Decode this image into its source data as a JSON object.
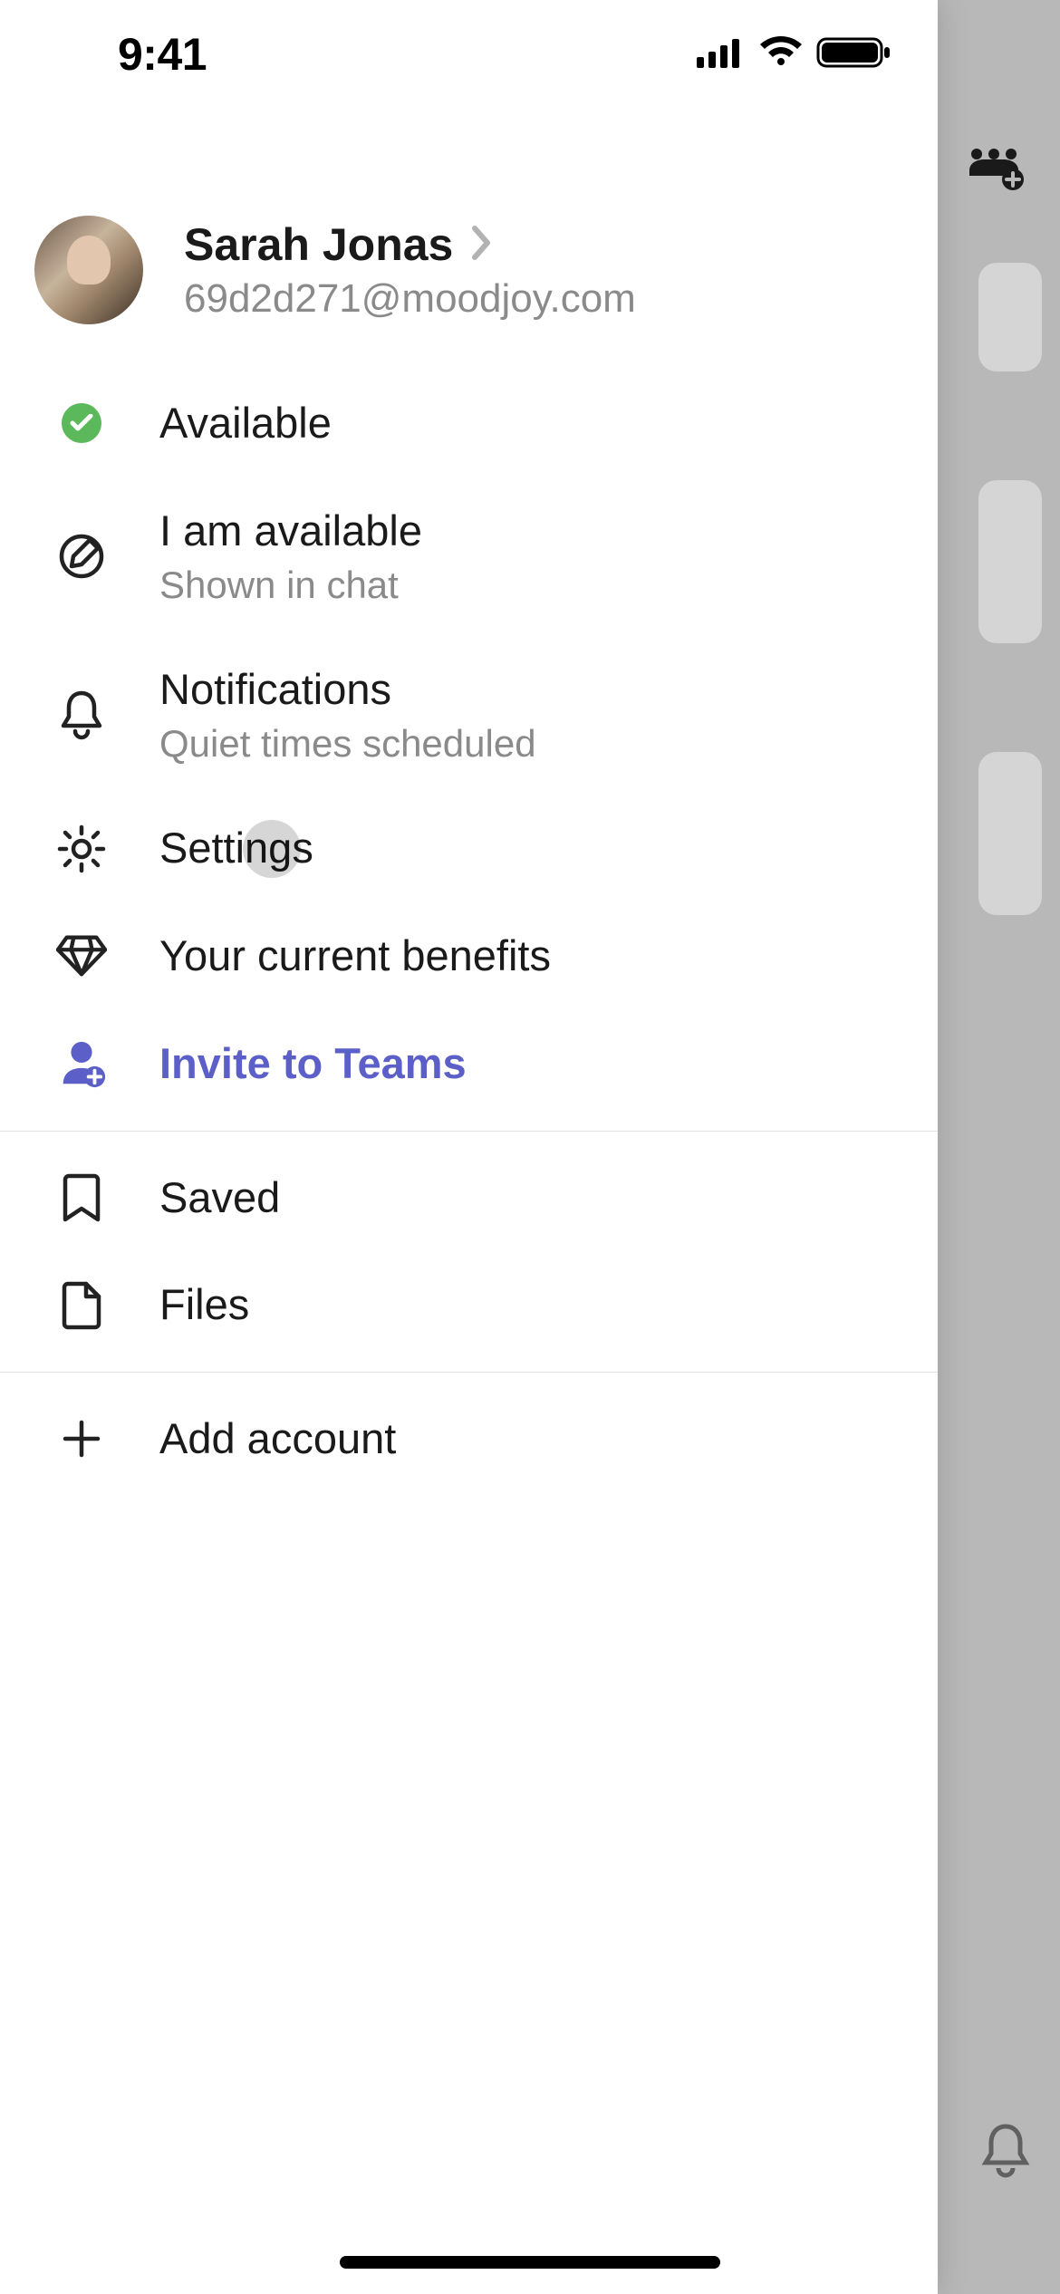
{
  "statusbar": {
    "time": "9:41"
  },
  "profile": {
    "name": "Sarah Jonas",
    "email": "69d2d271@moodjoy.com"
  },
  "status": {
    "label": "Available",
    "color": "#5bb85b"
  },
  "statusMessage": {
    "label": "I am available",
    "sub": "Shown in chat"
  },
  "notifications": {
    "label": "Notifications",
    "sub": "Quiet times scheduled"
  },
  "settings": {
    "label": "Settings"
  },
  "benefits": {
    "label": "Your current benefits"
  },
  "invite": {
    "label": "Invite to Teams",
    "accent": "#5b5fc7"
  },
  "saved": {
    "label": "Saved"
  },
  "files": {
    "label": "Files"
  },
  "addAccount": {
    "label": "Add account"
  }
}
